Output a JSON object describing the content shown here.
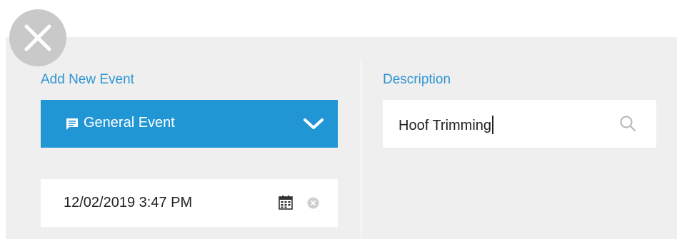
{
  "window": {
    "close_icon": "close-x-icon"
  },
  "add_event": {
    "label": "Add New Event",
    "event_type": {
      "selected": "General Event",
      "icon": "comment-icon",
      "dropdown_icon": "chevron-down-icon"
    },
    "datetime": {
      "value": "12/02/2019 3:47 PM",
      "calendar_icon": "calendar-icon",
      "clear_icon": "clear-circle-icon"
    }
  },
  "description": {
    "label": "Description",
    "value": "Hoof Trimming",
    "search_icon": "search-icon"
  },
  "colors": {
    "accent_label": "#2e95d3",
    "select_background": "#2196d4",
    "panel_background": "#efefef",
    "close_button": "#c9c9c9"
  }
}
